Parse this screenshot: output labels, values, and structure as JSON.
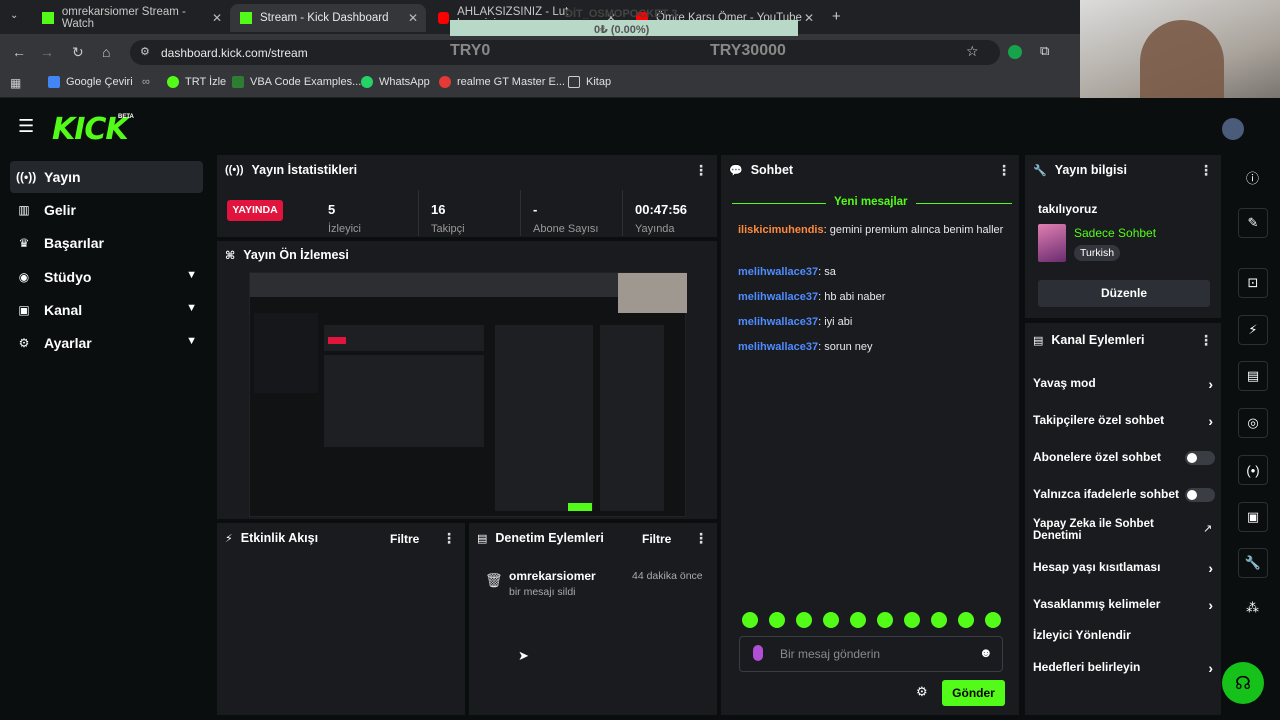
{
  "browser": {
    "tabs": [
      {
        "title": "omrekarsiomer Stream - Watch",
        "fav": "#53fc18"
      },
      {
        "title": "Stream - Kick Dashboard",
        "fav": "#53fc18"
      },
      {
        "title": "AHLAKSIZSINIZ - Lut kavminin...",
        "fav": "#ff0000"
      },
      {
        "title": "Ömre Karşı Ömer - YouTube",
        "fav": "#ff0000"
      }
    ],
    "url": "dashboard.kick.com/stream",
    "overlay_top": "DİT_OSMOPOCKET 3",
    "overlay_percent": "0₺ (0.00%)",
    "overlay_left": "TRY0",
    "overlay_right": "TRY30000",
    "bookmarks": [
      "Google Çeviri",
      "TRT İzle",
      "VBA Code Examples...",
      "WhatsApp",
      "realme GT Master E...",
      "Kitap"
    ]
  },
  "brand": {
    "logo": "KICK",
    "beta": "BETA"
  },
  "sidebar": {
    "items": [
      {
        "label": "Yayın",
        "icon": "broadcast-icon"
      },
      {
        "label": "Gelir",
        "icon": "chart-icon"
      },
      {
        "label": "Başarılar",
        "icon": "trophy-icon"
      },
      {
        "label": "Stüdyo",
        "icon": "studio-icon"
      },
      {
        "label": "Kanal",
        "icon": "channel-icon"
      },
      {
        "label": "Ayarlar",
        "icon": "gear-icon"
      }
    ]
  },
  "stats": {
    "title": "Yayın İstatistikleri",
    "live_badge": "YAYINDA",
    "cells": [
      {
        "value": "5",
        "label": "İzleyici"
      },
      {
        "value": "16",
        "label": "Takipçi"
      },
      {
        "value": "-",
        "label": "Abone Sayısı"
      },
      {
        "value": "00:47:56",
        "label": "Yayında"
      }
    ]
  },
  "preview": {
    "title": "Yayın Ön İzlemesi"
  },
  "activity": {
    "title": "Etkinlik Akışı",
    "filter": "Filtre"
  },
  "moderation": {
    "title": "Denetim Eylemleri",
    "filter": "Filtre",
    "entry": {
      "user": "omrekarsiomer",
      "action": "bir mesajı sildi",
      "time": "44 dakika önce"
    }
  },
  "chat": {
    "title": "Sohbet",
    "new_messages": "Yeni mesajlar",
    "messages": [
      {
        "user": "iliskicimuhendis",
        "text": ": gemini premium alınca benim haller",
        "color": "#ff8a3d"
      },
      {
        "user": "melihwallace37",
        "text": ": sa",
        "color": "#4f8cff"
      },
      {
        "user": "melihwallace37",
        "text": ": hb abi naber",
        "color": "#4f8cff"
      },
      {
        "user": "melihwallace37",
        "text": ": iyi abi",
        "color": "#4f8cff"
      },
      {
        "user": "melihwallace37",
        "text": ": sorun ney",
        "color": "#4f8cff"
      }
    ],
    "input_placeholder": "Bir mesaj gönderin",
    "send": "Gönder"
  },
  "stream_info": {
    "title": "Yayın bilgisi",
    "stream_title": "takılıyoruz",
    "category": "Sadece Sohbet",
    "language": "Turkish",
    "edit": "Düzenle"
  },
  "channel_actions": {
    "title": "Kanal Eylemleri",
    "items": [
      {
        "label": "Yavaş mod",
        "kind": "arrow"
      },
      {
        "label": "Takipçilere özel sohbet",
        "kind": "arrow"
      },
      {
        "label": "Abonelere özel sohbet",
        "kind": "toggle"
      },
      {
        "label": "Yalnızca ifadelerle sohbet",
        "kind": "toggle"
      },
      {
        "label": "Yapay Zeka ile Sohbet Denetimi",
        "kind": "external"
      },
      {
        "label": "Hesap yaşı kısıtlaması",
        "kind": "arrow"
      },
      {
        "label": "Yasaklanmış kelimeler",
        "kind": "arrow"
      },
      {
        "label": "İzleyici Yönlendir",
        "kind": "none"
      },
      {
        "label": "Hedefleri belirleyin",
        "kind": "arrow"
      }
    ]
  },
  "colors": {
    "accent": "#53fc18",
    "live": "#e0143c",
    "panel": "#191b1f"
  }
}
